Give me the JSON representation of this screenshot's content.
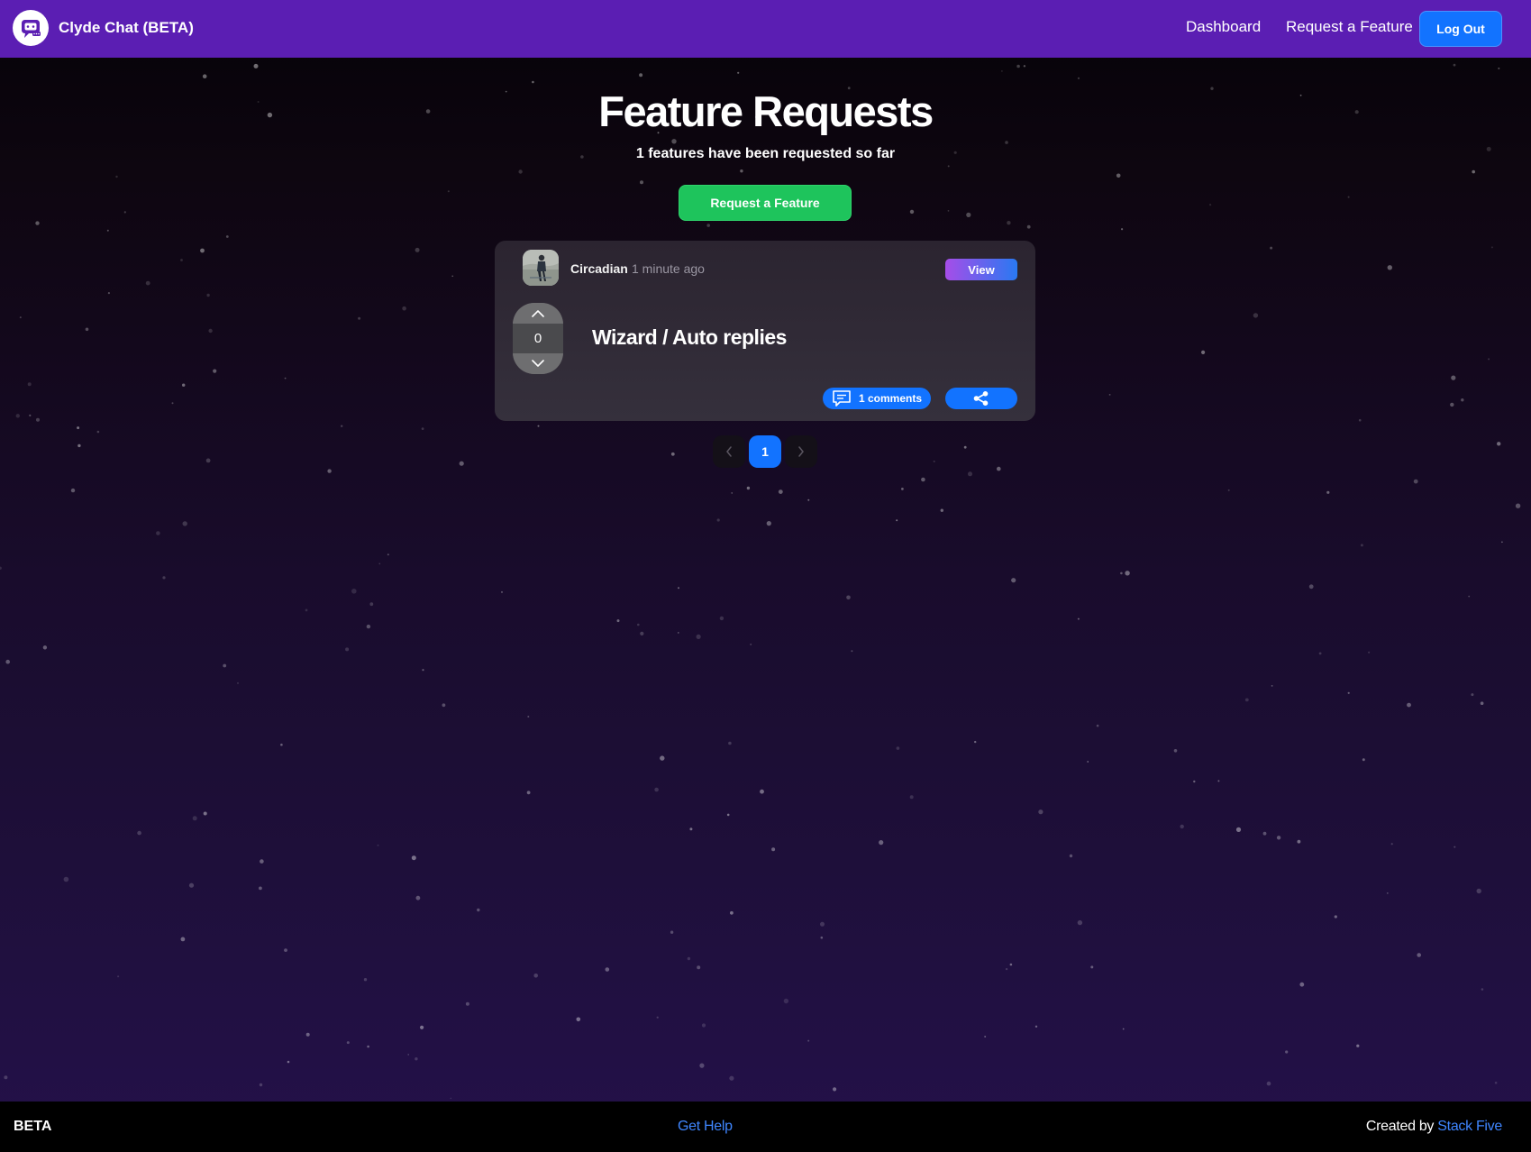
{
  "navbar": {
    "brand": "Clyde Chat (BETA)",
    "links": [
      "Dashboard",
      "Request a Feature"
    ],
    "logout_label": "Log Out"
  },
  "hero": {
    "title": "Feature Requests",
    "subtitle": "1 features have been requested so far",
    "request_button": "Request a Feature"
  },
  "requests": [
    {
      "author": "Circadian",
      "time_ago": "1 minute ago",
      "view_label": "View",
      "votes": "0",
      "title": "Wizard / Auto replies",
      "comments_label": "1 comments"
    }
  ],
  "pagination": {
    "prev_icon": "chevron-left-icon",
    "current_page": "1",
    "next_icon": "chevron-right-icon"
  },
  "footer": {
    "beta": "BETA",
    "help": "Get Help",
    "created_by": "Created by",
    "author_link": "Stack Five"
  },
  "colors": {
    "navbar": "#5b1eb3",
    "primary": "#1273ff",
    "success": "#1ec45c",
    "link": "#3f86ff"
  }
}
